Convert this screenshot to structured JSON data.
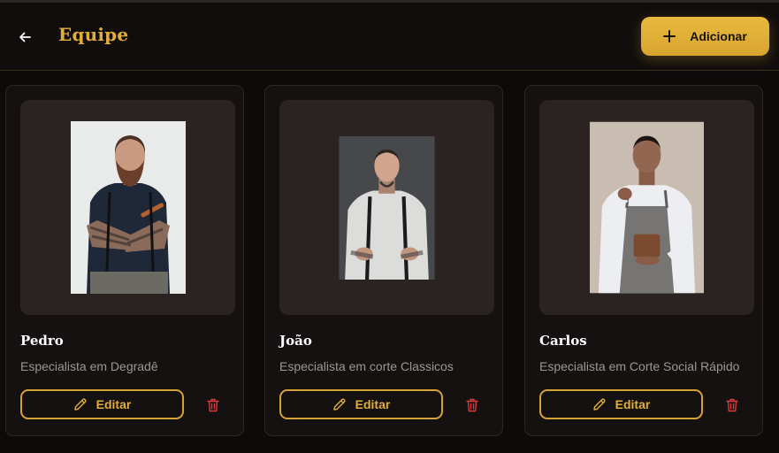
{
  "header": {
    "title": "Equipe",
    "add_label": "Adicionar"
  },
  "icons": {
    "back": "arrow-left-icon",
    "add": "plus-icon",
    "edit": "pencil-icon",
    "delete": "trash-icon"
  },
  "colors": {
    "accent": "#e2ad3a",
    "delete": "#d93b3b",
    "background": "#0d0b0a"
  },
  "team": [
    {
      "name": "Pedro",
      "role": "Especialista em Degradê",
      "edit_label": "Editar"
    },
    {
      "name": "João",
      "role": "Especialista em corte Classicos",
      "edit_label": "Editar"
    },
    {
      "name": "Carlos",
      "role": "Especialista em Corte Social Rápido",
      "edit_label": "Editar"
    }
  ]
}
